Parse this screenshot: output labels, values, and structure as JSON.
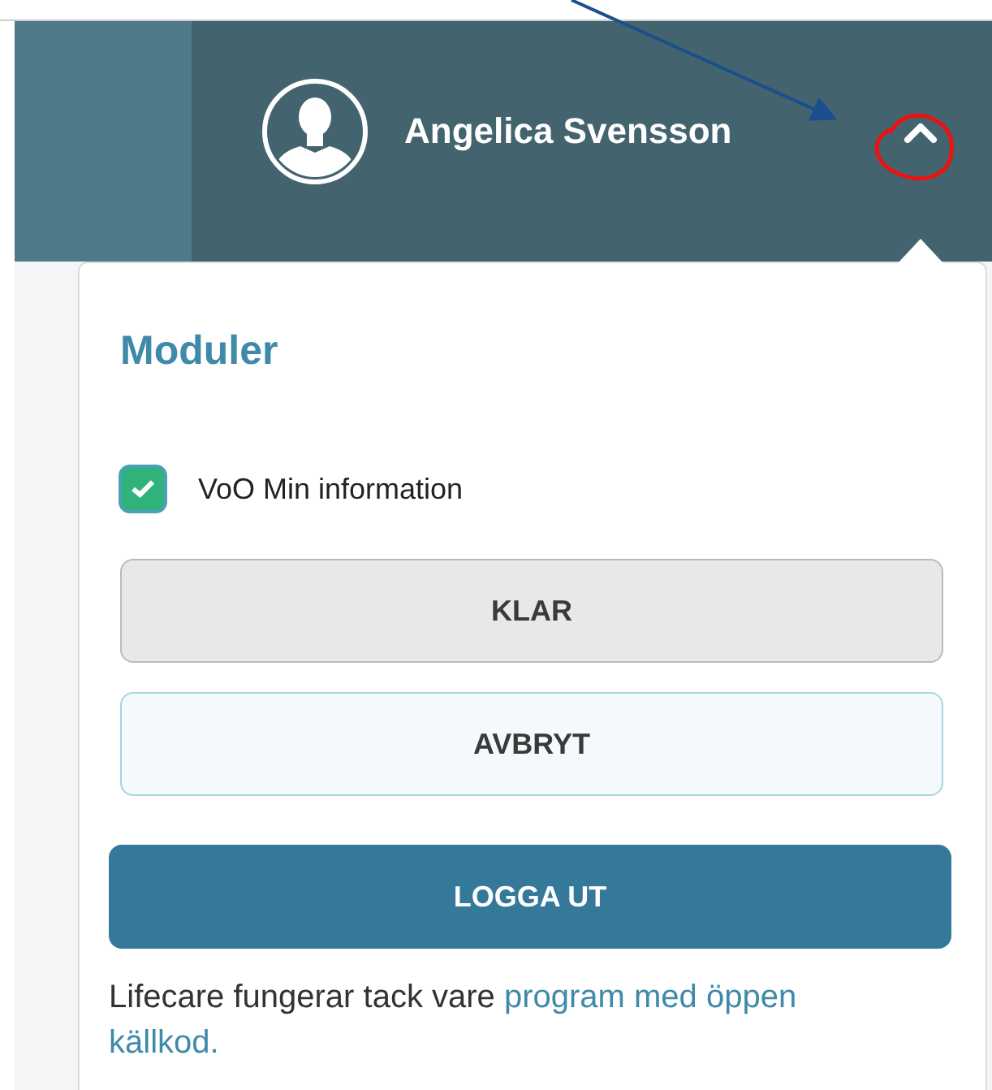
{
  "header": {
    "user_name": "Angelica Svensson",
    "menu_expanded": true
  },
  "popover": {
    "title": "Moduler",
    "modules": [
      {
        "label": "VoO Min information",
        "checked": true
      }
    ],
    "buttons": [
      {
        "label": "KLAR",
        "kind": "secondary"
      },
      {
        "label": "AVBRYT",
        "kind": "outline"
      },
      {
        "label": "LOGGA UT",
        "kind": "primary"
      }
    ],
    "footer": {
      "text": "Lifecare fungerar tack vare ",
      "link_lines": [
        "program med öppen",
        "källkod."
      ]
    }
  },
  "annotations": {
    "arrow": true,
    "highlight_circle": true
  }
}
